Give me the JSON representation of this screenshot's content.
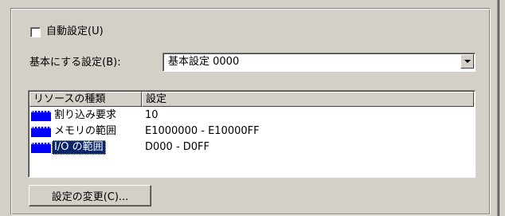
{
  "auto_setting": {
    "label": "自動設定(U)",
    "checked": false
  },
  "basis": {
    "label": "基本にする設定(B):",
    "selected": "基本設定 0000"
  },
  "resources": {
    "columns": [
      "リソースの種類",
      "設定"
    ],
    "rows": [
      {
        "type": "割り込み要求",
        "setting": "10",
        "selected": false
      },
      {
        "type": "メモリの範囲",
        "setting": "E1000000 - E10000FF",
        "selected": false
      },
      {
        "type": "I/O の範囲",
        "setting": "D000 - D0FF",
        "selected": true
      }
    ]
  },
  "change_button": {
    "label": "設定の変更(C)..."
  },
  "colors": {
    "face": "#d4d0c8",
    "selection": "#0a246a",
    "resource_icon": "#0000ff"
  }
}
